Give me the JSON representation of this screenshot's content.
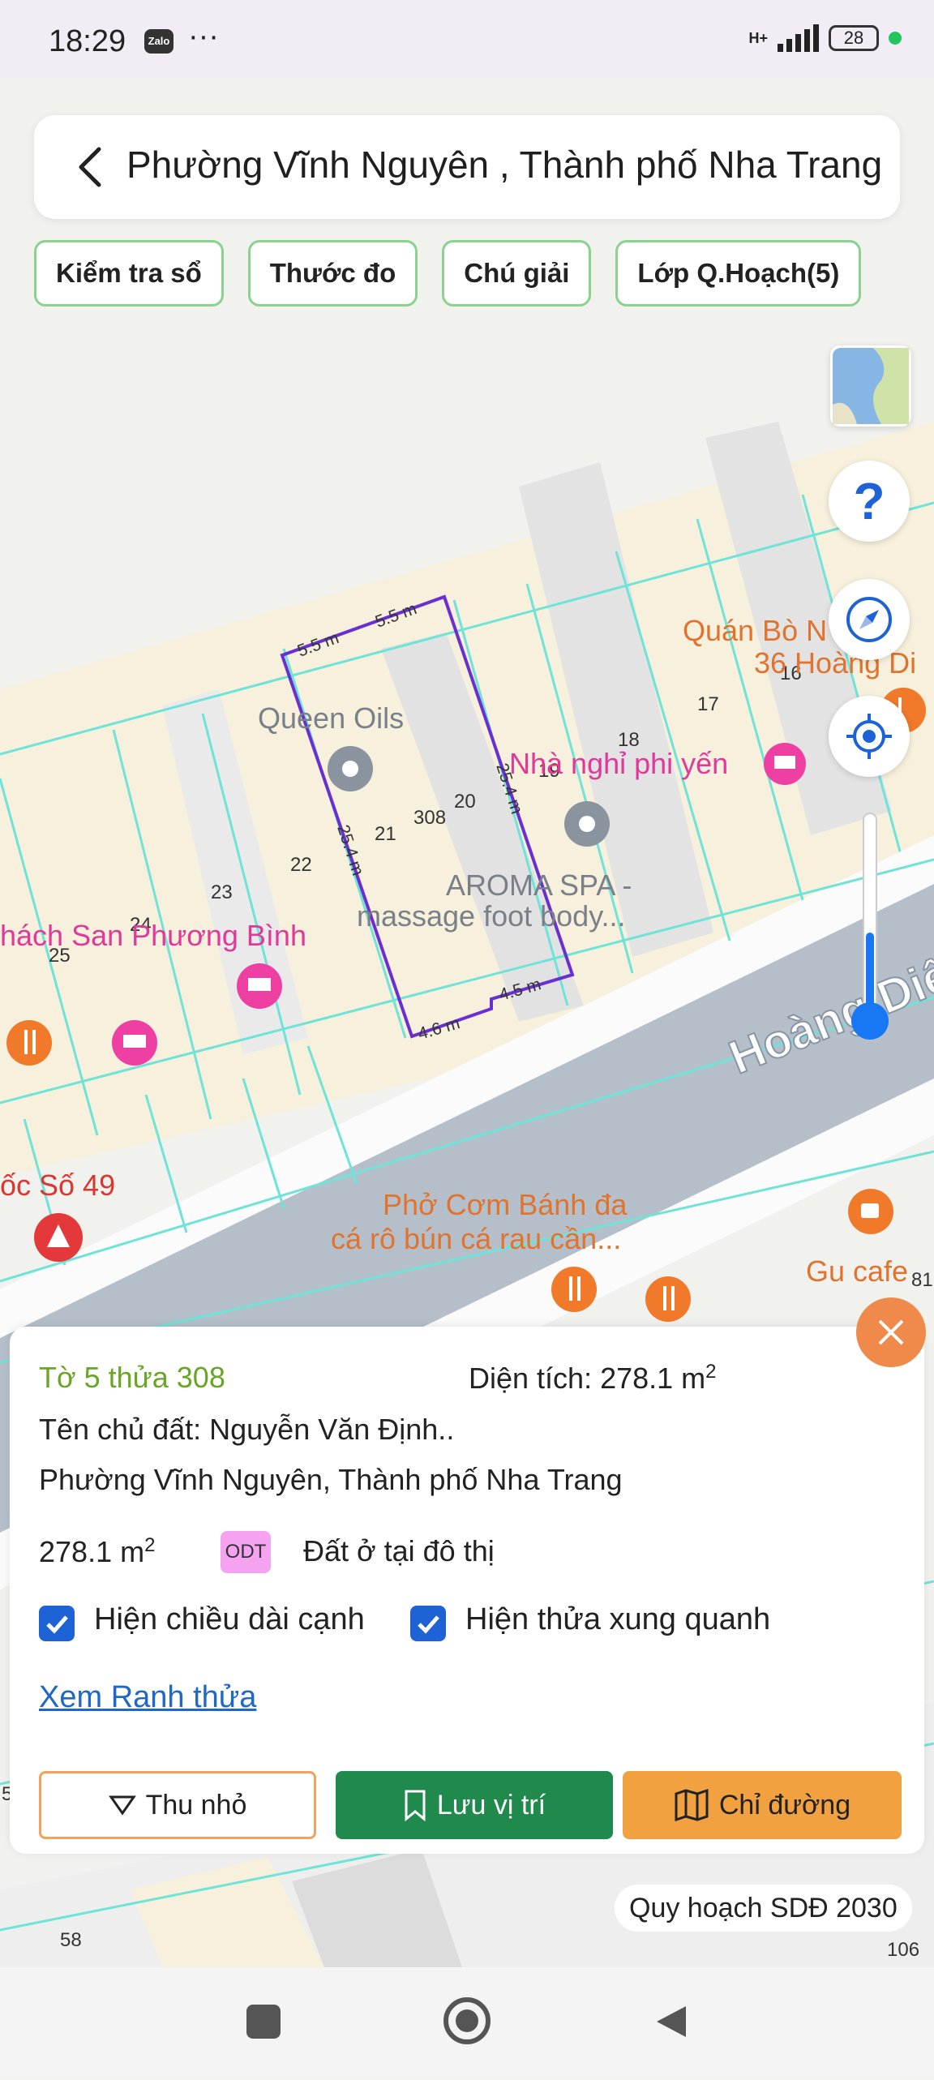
{
  "status_bar": {
    "time": "18:29",
    "app_badge": "Zalo",
    "more": "···",
    "network": "H+",
    "battery": "28"
  },
  "header": {
    "title": "Phường Vĩnh Nguyên , Thành phố Nha Trang"
  },
  "chips": [
    "Kiểm tra sổ",
    "Thước đo",
    "Chú giải",
    "Lớp Q.Hoạch(5)"
  ],
  "map": {
    "road_name": "Hoàng Diệ",
    "pois": {
      "queen_oils": "Queen Oils",
      "nha_nghi": "Nhà nghỉ phi yến",
      "aroma_spa_1": "AROMA SPA -",
      "aroma_spa_2": "massage foot body...",
      "khach_san": "hách San Phương Bình",
      "quan_bo_1": "Quán Bò N",
      "quan_bo_2": "36 Hoàng Di",
      "pho_com_1": "Phở Cơm Bánh đa",
      "pho_com_2": "cá rô bún cá rau cần...",
      "gu_cafe": "Gu cafe",
      "oc_so": "ốc Số 49"
    },
    "parcel_numbers": [
      "16",
      "17",
      "18",
      "19",
      "20",
      "21",
      "22",
      "23",
      "24",
      "25",
      "308",
      "81",
      "58",
      "106",
      "5"
    ],
    "edge_lengths": [
      "5.5 m",
      "5.5 m",
      "25.4 m",
      "25.4 m",
      "4.5 m",
      "4.6 m"
    ]
  },
  "panel": {
    "parcel": "Tờ 5 thửa 308",
    "area_label": "Diện tích: 278.1 m",
    "area_sup": "2",
    "owner": "Tên chủ đất: Nguyễn Văn Định..",
    "address": "Phường Vĩnh Nguyên, Thành phố Nha Trang",
    "area_value": "278.1 m",
    "area_value_sup": "2",
    "land_code": "ODT",
    "land_type": "Đất ở tại đô thị",
    "check1_label": "Hiện chiều dài cạnh",
    "check1_checked": true,
    "check2_label": "Hiện thửa xung quanh",
    "check2_checked": true,
    "link": "Xem Ranh thửa",
    "btn_shrink": "Thu nhỏ",
    "btn_save": "Lưu vị trí",
    "btn_directions": "Chỉ đường"
  },
  "plan_label": "Quy hoạch SDĐ 2030",
  "colors": {
    "accent_green": "#1f8a4c",
    "accent_orange": "#f2a140",
    "parcel_outline": "#6a2fd0",
    "zoom_blue": "#1877f2"
  }
}
